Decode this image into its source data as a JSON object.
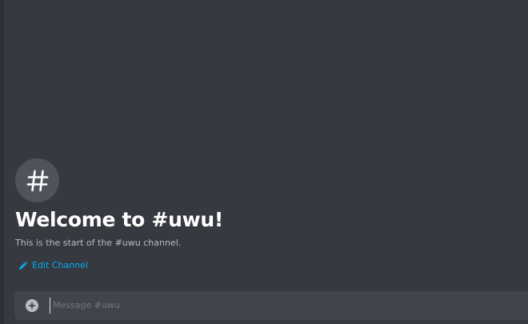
{
  "channel": {
    "icon": "hash-icon",
    "welcome_title": "Welcome to #uwu!",
    "welcome_subtitle": "This is the start of the #uwu channel.",
    "edit_label": "Edit Channel",
    "edit_icon": "pencil-icon"
  },
  "composer": {
    "attach_icon": "plus-circle-icon",
    "placeholder": "Message #uwu",
    "value": ""
  },
  "colors": {
    "background": "#36393f",
    "input_background": "#40444b",
    "link": "#00b0f4",
    "title": "#ffffff",
    "muted": "#b9bbbe"
  }
}
